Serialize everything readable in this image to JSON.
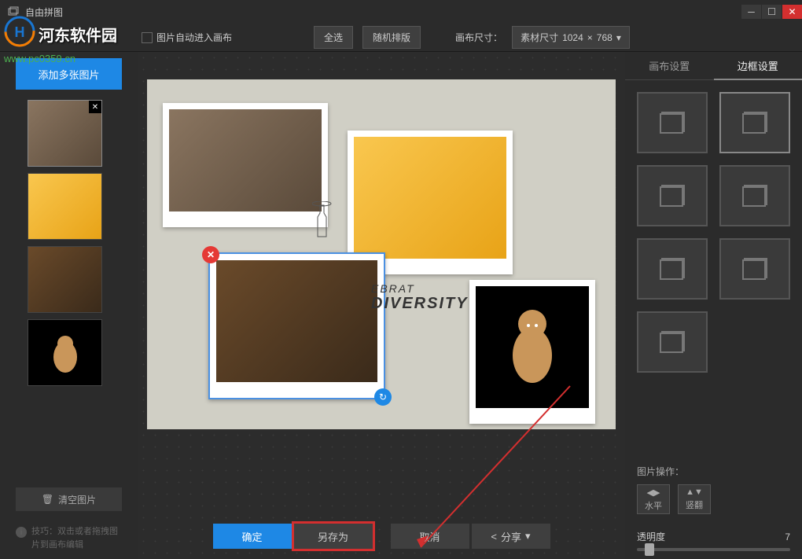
{
  "titlebar": {
    "title": "自由拼图"
  },
  "toolbar": {
    "auto_enter_label": "图片自动进入画布",
    "select_all": "全选",
    "random_layout": "随机排版",
    "canvas_size_label": "画布尺寸：",
    "size_prefix": "素材尺寸",
    "size_w": "1024",
    "size_sep": "×",
    "size_h": "768"
  },
  "sidebar": {
    "add_label": "添加多张图片",
    "clear_label": "清空图片",
    "tip": "技巧：双击或者拖拽图片到画布编辑"
  },
  "right": {
    "tab_canvas": "画布设置",
    "tab_border": "边框设置",
    "ops_label": "图片操作：",
    "flip_h": "水平",
    "flip_v": "竖翻",
    "opacity_label": "透明度",
    "opacity_value": "7"
  },
  "actions": {
    "confirm": "确定",
    "save_as": "另存为",
    "cancel": "取消",
    "share": "分享"
  },
  "canvas_deco": {
    "line1": "EBRAT",
    "line2": "DIVERSITY"
  },
  "watermark": {
    "brand_text": "河东软件园",
    "url": "www.pc0359.cn"
  }
}
